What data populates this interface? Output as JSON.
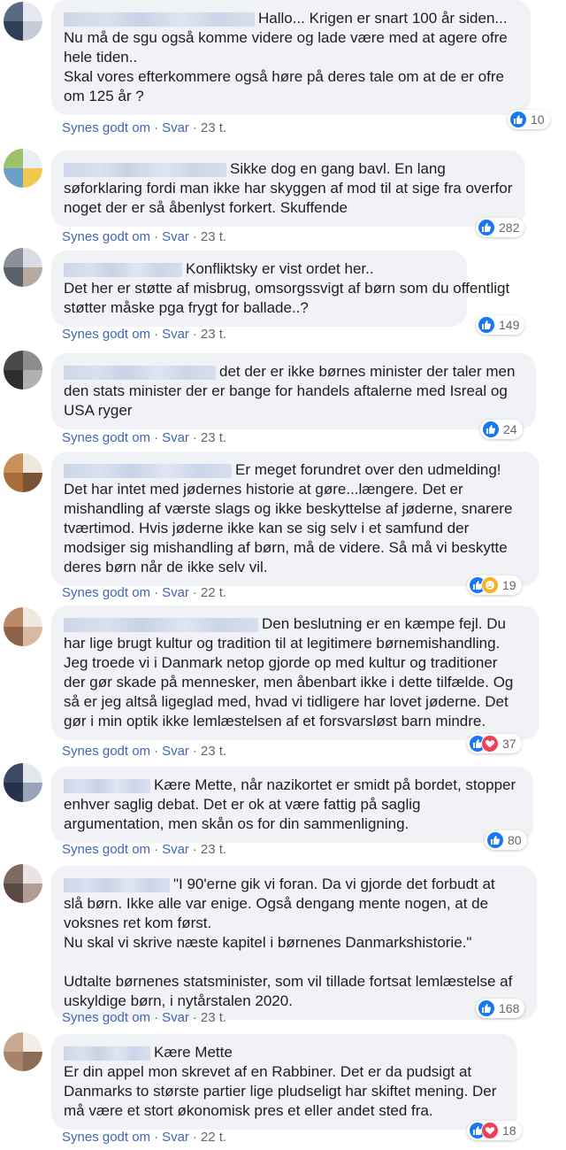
{
  "actions": {
    "like": "Synes godt om",
    "reply": "Svar",
    "separator": "·"
  },
  "comments": [
    {
      "avatar_colors": [
        "#5a6a84",
        "#e6e9f0",
        "#2f3d55",
        "#c7cdd8"
      ],
      "lines": [
        "Hallo... Krigen er snart 100 år siden...",
        "Nu må de sgu også komme videre og lade være med at agere ofre",
        "hele tiden..",
        "Skal vores efterkommere også høre på deres tale om at de er ofre",
        "om 125 år ?"
      ],
      "time": "23 t.",
      "reactions": [
        "like"
      ],
      "count": "10"
    },
    {
      "avatar_colors": [
        "#9cc36b",
        "#e8eef5",
        "#6aa0c8",
        "#f2c94c"
      ],
      "lines": [
        "Sikke dog en gang bavl. En lang",
        "søforklaring fordi man ikke har skyggen af mod til at sige fra overfor",
        "noget der er så åbenlyst forkert. Skuffende"
      ],
      "time": "23 t.",
      "reactions": [
        "like"
      ],
      "count": "282"
    },
    {
      "avatar_colors": [
        "#8a8f99",
        "#d9dde3",
        "#5b5f66",
        "#b8a9a0"
      ],
      "lines": [
        "Konfliktsky er vist ordet her..",
        "Det her er støtte af misbrug, omsorgssvigt af børn som du offentligt",
        "støtter måske pga frygt for ballade..?"
      ],
      "time": "23 t.",
      "reactions": [
        "like"
      ],
      "count": "149"
    },
    {
      "avatar_colors": [
        "#4a4a4a",
        "#8d8d8d",
        "#2e2e2e",
        "#b0b0b0"
      ],
      "lines": [
        "det der er ikke børnes minister der taler men",
        "den stats minister der er bange for handels aftalerne med Isreal og",
        "USA ryger"
      ],
      "time": "23 t.",
      "reactions": [
        "like"
      ],
      "count": "24"
    },
    {
      "avatar_colors": [
        "#c8915a",
        "#efe6dc",
        "#a86b3a",
        "#7a5235"
      ],
      "lines": [
        "Er meget forundret over den udmelding!",
        "Det har intet med jødernes historie at gøre...længere. Det er",
        "mishandling af værste slags og ikke beskyttelse af jøderne, snarere",
        "tværtimod. Hvis jøderne ikke kan se sig selv i et samfund der",
        "modsiger sig mishandling af børn, må de videre. Så må vi beskytte",
        "deres børn når de ikke selv vil."
      ],
      "time": "22 t.",
      "reactions": [
        "like",
        "care"
      ],
      "count": "19"
    },
    {
      "avatar_colors": [
        "#b88a6a",
        "#f1e8e0",
        "#8f6148",
        "#d9b9a0"
      ],
      "lines": [
        "Den beslutning er en kæmpe fejl. Du",
        "har lige brugt kultur og tradition til at legitimere børnemishandling.",
        "Jeg troede vi i Danmark netop gjorde op med kultur og traditioner",
        "der gør skade på mennesker, men åbenbart ikke i dette tilfælde. Og",
        "så er jeg altså ligeglad med, hvad vi tidligere har lovet jøderne. Det",
        "gør i min optik ikke lemlæstelsen af et forsvarsløst barn mindre."
      ],
      "time": "23 t.",
      "reactions": [
        "like",
        "love"
      ],
      "count": "37"
    },
    {
      "avatar_colors": [
        "#3d4a66",
        "#e4e7ee",
        "#27314a",
        "#9aa4b8"
      ],
      "lines": [
        "Kære Mette, når nazikortet er smidt på bordet, stopper",
        "enhver saglig debat. Det er ok at være fattig på saglig",
        "argumentation, men skån os for din sammenligning."
      ],
      "time": "23 t.",
      "reactions": [
        "like"
      ],
      "count": "80"
    },
    {
      "avatar_colors": [
        "#7e6a62",
        "#e9e4e1",
        "#5a4a44",
        "#b39d93"
      ],
      "lines": [
        "\"I 90'erne gik vi foran. Da vi gjorde det forbudt at",
        "slå børn. Ikke alle var enige. Også dengang mente nogen, at de",
        "voksnes ret kom først.",
        "Nu skal vi skrive næste kapitel i børnenes Danmarkshistorie.\"",
        "",
        "Udtalte børnenes statsminister, som vil tillade fortsat lemlæstelse af",
        "uskyldige børn, i nytårstalen 2020."
      ],
      "time": "23 t.",
      "reactions": [
        "like"
      ],
      "count": "168"
    },
    {
      "avatar_colors": [
        "#c9a98e",
        "#f4ede6",
        "#a8826a",
        "#8c6b57"
      ],
      "lines": [
        "Kære Mette",
        "Er din appel mon skrevet af en Rabbiner. Det er da pudsigt at",
        "Danmarks to største partier lige pludseligt har skiftet mening. Der",
        "må være et stort økonomisk pres et eller andet sted fra."
      ],
      "time": "22 t.",
      "reactions": [
        "like",
        "love"
      ],
      "count": "18"
    }
  ]
}
